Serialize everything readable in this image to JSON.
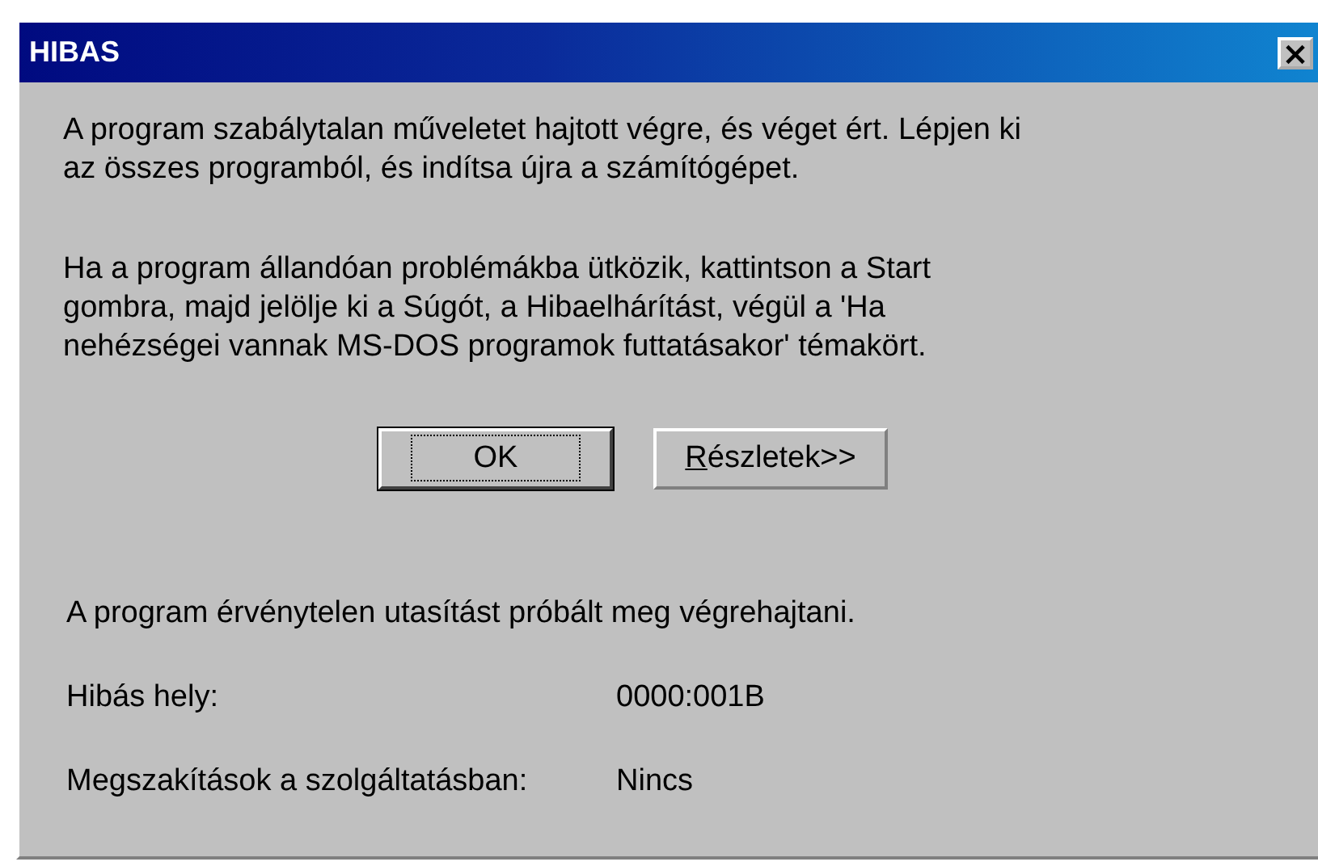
{
  "window": {
    "title": "HIBAS",
    "close": "×"
  },
  "message": [
    "A program szabálytalan műveletet hajtott végre, és véget ért.  Lépjen ki az összes programból, és indítsa újra a számítógépet.",
    "Ha a program állandóan problémákba ütközik, kattintson a Start gombra, majd jelölje ki a Súgót, a Hibaelhárítást, végül a 'Ha nehézségei vannak MS-DOS programok futtatásakor' témakört."
  ],
  "buttons": [
    {
      "rest": "OK",
      "default": true
    },
    {
      "mnemonic": "R",
      "rest": "észletek>>",
      "default": false
    }
  ],
  "details": {
    "summary": "A program érvénytelen utasítást próbált meg végrehajtani.",
    "rows": [
      {
        "label": "Hibás hely:",
        "value": "0000:001B"
      },
      {
        "label": "Megszakítások a szolgáltatásban:",
        "value": "Nincs"
      }
    ]
  }
}
